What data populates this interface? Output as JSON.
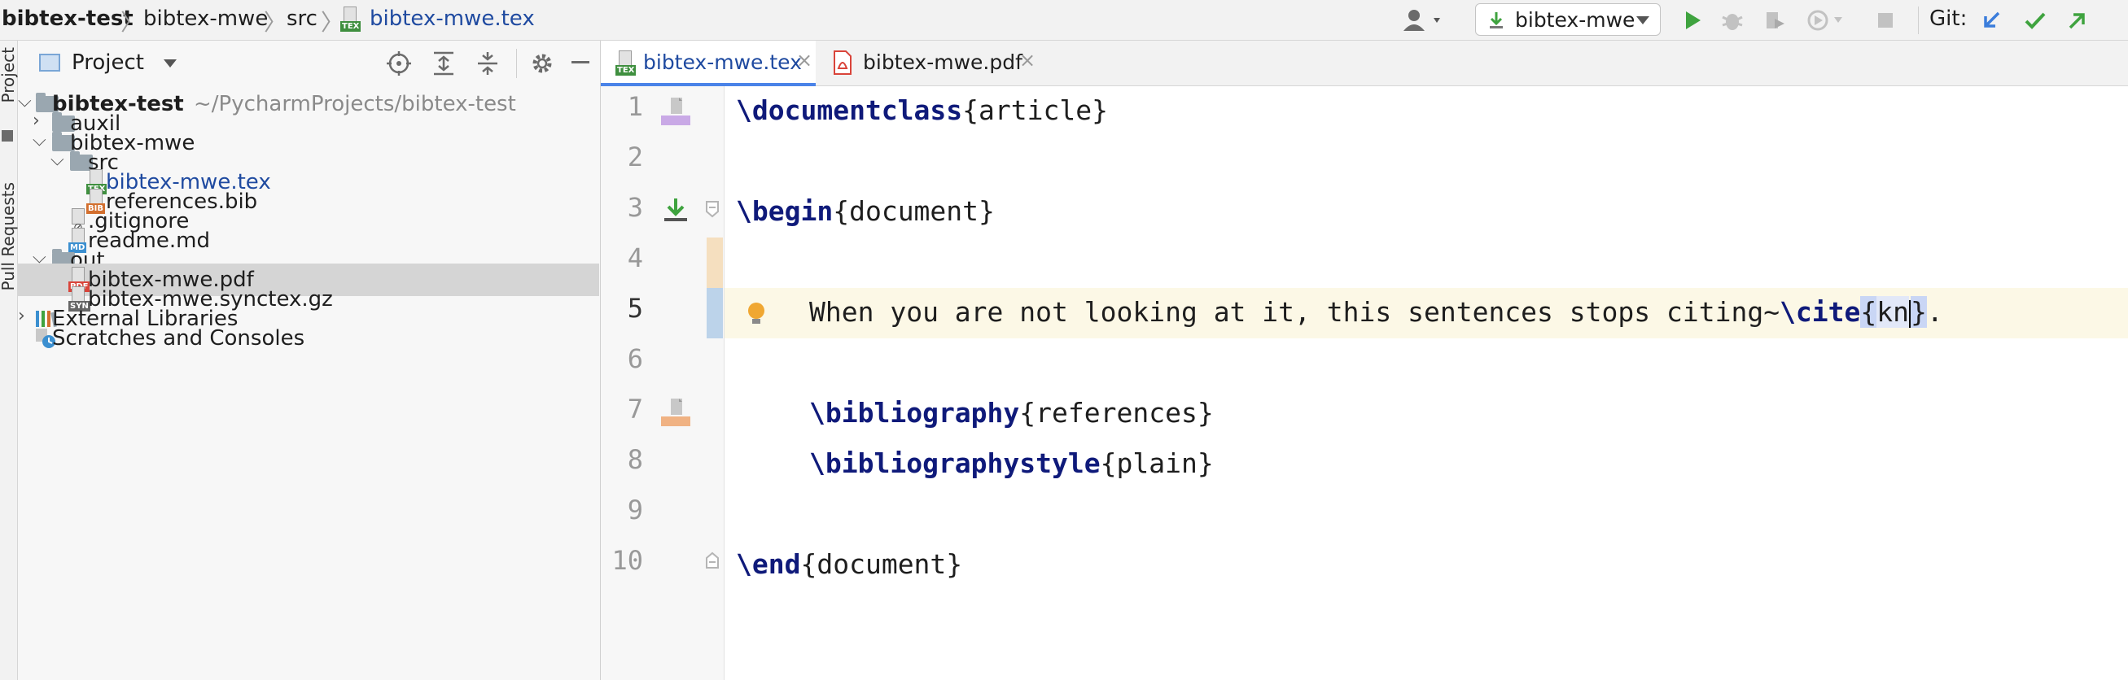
{
  "breadcrumb": {
    "project": "bibtex-test",
    "module": "bibtex-mwe",
    "folder": "src",
    "file": "bibtex-mwe.tex",
    "file_tag": "TEX"
  },
  "toolbar": {
    "run_config": "bibtex-mwe",
    "git_label": "Git:"
  },
  "side_tabs": {
    "project": "Project",
    "pull_requests": "Pull Requests"
  },
  "project_panel": {
    "title": "Project",
    "tree": [
      {
        "label": "bibtex-test",
        "path": "~/PycharmProjects/bibtex-test"
      },
      {
        "label": "auxil"
      },
      {
        "label": "bibtex-mwe"
      },
      {
        "label": "src"
      },
      {
        "label": "bibtex-mwe.tex",
        "tag": "TEX"
      },
      {
        "label": "references.bib",
        "tag": "BIB"
      },
      {
        "label": ".gitignore"
      },
      {
        "label": "readme.md",
        "tag": "MD"
      },
      {
        "label": "out"
      },
      {
        "label": "bibtex-mwe.pdf",
        "tag": "PDF"
      },
      {
        "label": "bibtex-mwe.synctex.gz",
        "tag": "SYN"
      },
      {
        "label": "External Libraries"
      },
      {
        "label": "Scratches and Consoles"
      }
    ]
  },
  "editor": {
    "tabs": [
      {
        "label": "bibtex-mwe.tex",
        "tag": "TEX"
      },
      {
        "label": "bibtex-mwe.pdf"
      }
    ],
    "close_glyph": "×",
    "line_numbers": [
      "1",
      "2",
      "3",
      "4",
      "5",
      "6",
      "7",
      "8",
      "9",
      "10"
    ],
    "lines": {
      "l1_cmd": "\\documentclass",
      "l1_arg": "{article}",
      "l3_cmd": "\\begin",
      "l3_arg": "{document}",
      "l5_text": "When you are not looking at it, this sentences stops citing~",
      "l5_cmd": "\\cite",
      "l5_open": "{",
      "l5_arg": "kn",
      "l5_close": "}",
      "l5_end": ".",
      "l7_cmd": "\\bibliography",
      "l7_arg": "{references}",
      "l8_cmd": "\\bibliographystyle",
      "l8_arg": "{plain}",
      "l10_cmd": "\\end",
      "l10_arg": "{document}"
    }
  },
  "colors": {
    "accent": "#4a83e8",
    "keyword": "#0f1a7a",
    "run_green": "#3fa33f",
    "tex_tag": "#3f8f3f",
    "bib_tag": "#d36f2e",
    "pdf_tag": "#d9443a",
    "md_tag": "#3b8fd0",
    "selection": "#d5d5d5"
  }
}
